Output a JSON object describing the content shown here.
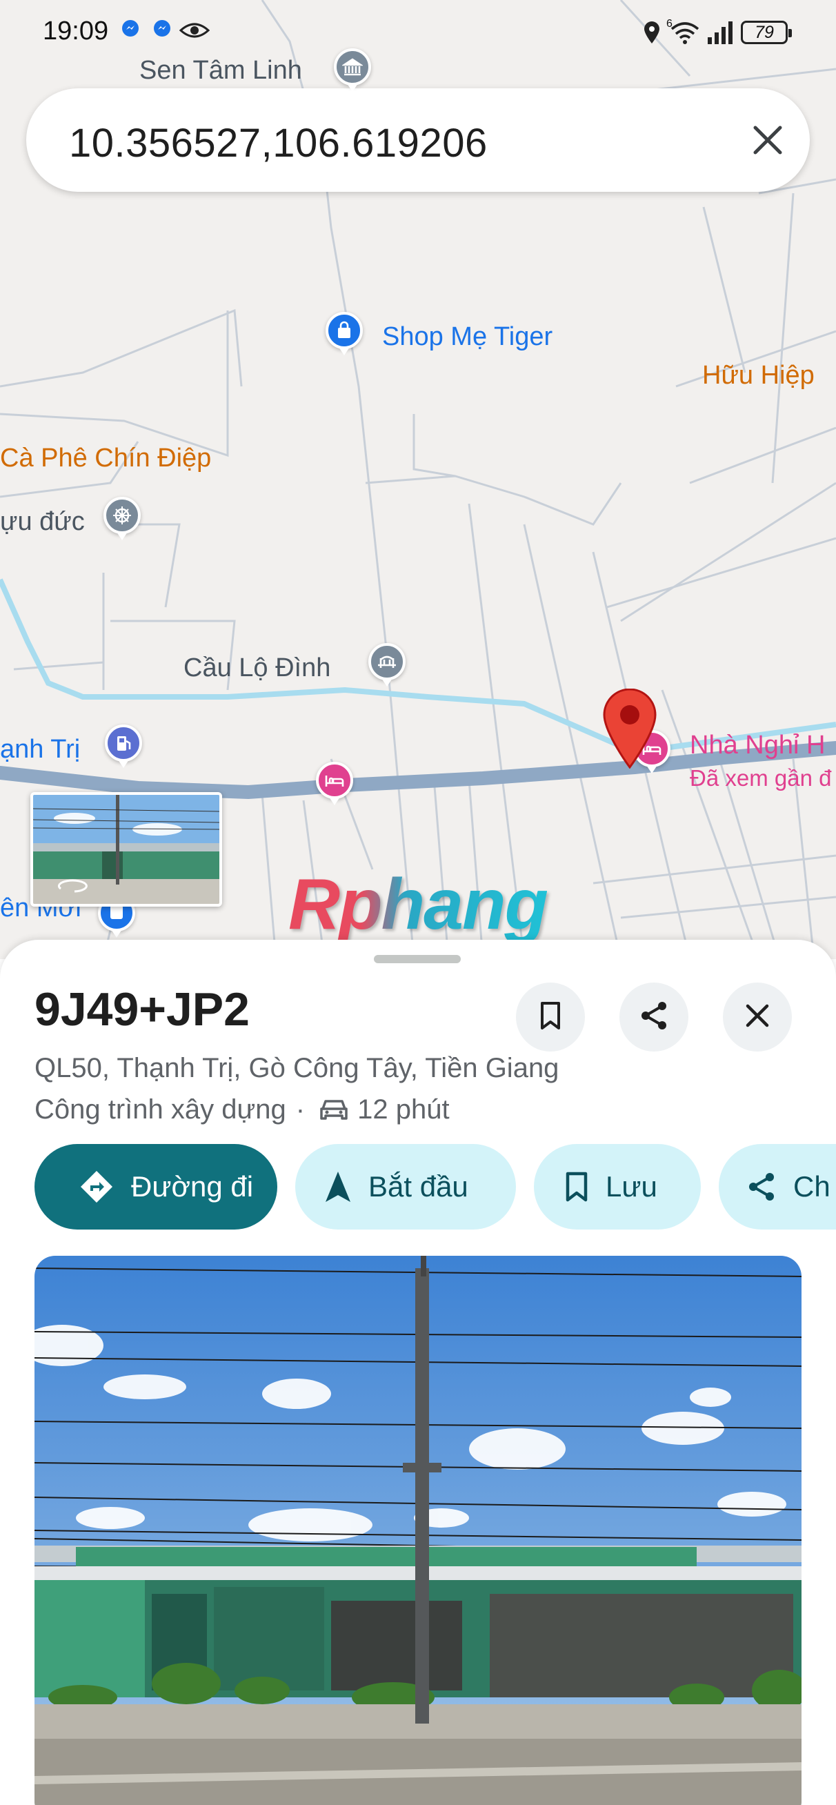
{
  "status_bar": {
    "time": "19:09",
    "signal_label": "6",
    "battery": "79",
    "icons": [
      "messenger-icon",
      "messenger-icon",
      "eye-icon",
      "location-icon",
      "wifi-icon",
      "signal-icon",
      "battery-icon"
    ]
  },
  "search": {
    "query": "10.356527,106.619206",
    "clear_icon": "close-icon"
  },
  "map": {
    "labels": {
      "sen_tam_linh": "Sen Tâm Linh",
      "shop_me_tiger": "Shop Mẹ Tiger",
      "huu_hiep": "Hữu Hiệp",
      "ca_phe": "Cà Phê Chín Điệp",
      "uu_duc": "ựu đức",
      "cau_lo_dinh": "Cầu Lộ Đình",
      "thanh_tri": "ạnh Trị",
      "nha_nghi": "Nhà Nghỉ H",
      "da_xem": "Đã xem gần đ",
      "en_moi": "ên Mới"
    },
    "watermark": "Rphang",
    "colors": {
      "map_bg": "#f2f0ee",
      "road": "#8fa8c4",
      "river": "#a8dcef",
      "poi_blue": "#1a73e8",
      "poi_orange": "#d16b04",
      "poi_pink": "#e0408f",
      "marker_red": "#ea4335"
    }
  },
  "place": {
    "plus_code": "9J49+JP2",
    "address": "QL50, Thạnh Trị, Gò Công Tây, Tiền Giang",
    "category": "Công trình xây dựng",
    "separator": "·",
    "travel_time": "12 phút",
    "actions": [
      {
        "label": "Đường đi",
        "icon": "directions-icon"
      },
      {
        "label": "Bắt đầu",
        "icon": "navigation-arrow-icon"
      },
      {
        "label": "Lưu",
        "icon": "bookmark-icon"
      },
      {
        "label": "Ch",
        "icon": "share-icon"
      }
    ],
    "header_buttons": [
      "bookmark-icon",
      "share-icon",
      "close-icon"
    ]
  }
}
